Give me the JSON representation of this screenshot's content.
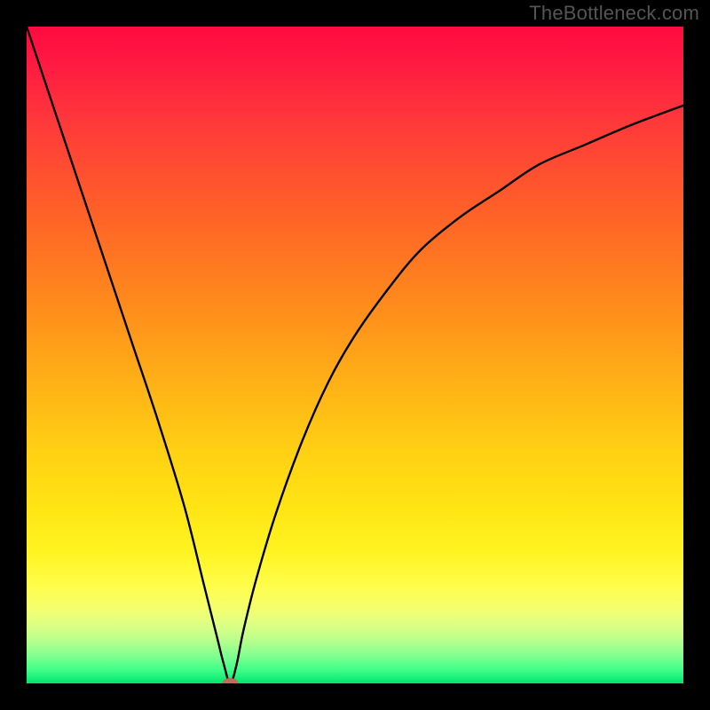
{
  "watermark": "TheBottleneck.com",
  "colors": {
    "background": "#000000",
    "watermark_text": "#555555",
    "curve_stroke": "#000000",
    "minimum_marker": "#c46a5a",
    "gradient_top": "#ff0a3f",
    "gradient_mid": "#ffd113",
    "gradient_bottom": "#00e46e"
  },
  "chart_data": {
    "type": "line",
    "title": "",
    "xlabel": "",
    "ylabel": "",
    "xlim": [
      0,
      100
    ],
    "ylim": [
      0,
      100
    ],
    "grid": false,
    "legend": false,
    "annotations": [
      {
        "kind": "marker",
        "shape": "ellipse",
        "x": 31,
        "y": 0,
        "color": "#c46a5a",
        "note": "minimum point"
      }
    ],
    "series": [
      {
        "name": "curve",
        "note": "V-shaped curve: steep descent from upper-left to a minimum near x≈31, then slower asymptotic rise toward upper-right. Y values are percentages of plot height from the bottom.",
        "x": [
          0,
          4,
          8,
          12,
          16,
          20,
          24,
          27,
          29,
          30,
          31,
          32,
          33,
          35,
          38,
          42,
          46,
          50,
          55,
          60,
          66,
          72,
          78,
          85,
          92,
          100
        ],
        "y": [
          100,
          88,
          76,
          64,
          52,
          40,
          27,
          15,
          7,
          3,
          0,
          3,
          8,
          16,
          26,
          37,
          46,
          53,
          60,
          66,
          71,
          75,
          79,
          82,
          85,
          88
        ]
      }
    ]
  }
}
